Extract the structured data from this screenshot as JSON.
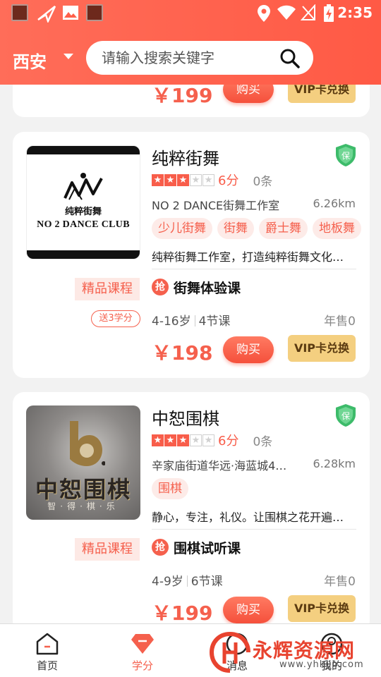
{
  "status_bar": {
    "time": "2:35"
  },
  "header": {
    "city": "西安",
    "search_placeholder": "请输入搜索关键字"
  },
  "prev_card": {
    "price": "￥199",
    "buy_label": "购买",
    "vip_label": "VIP卡兑换"
  },
  "cards": [
    {
      "title": "纯粹街舞",
      "thumb_cn": "纯粹街舞",
      "thumb_en": "NO 2 DANCE CLUB",
      "rating_stars": 3,
      "score": "6分",
      "reviews": "0条",
      "address": "NO 2 DANCE街舞工作室",
      "distance": "6.26km",
      "tags": [
        "少儿街舞",
        "街舞",
        "爵士舞",
        "地板舞"
      ],
      "description": "纯粹街舞工作室，打造纯粹街舞文化…",
      "course_label": "精品课程",
      "credit_badge": "送3学分",
      "grab_icon": "抢",
      "course_name": "街舞体验课",
      "age": "4-16岁",
      "lessons": "4节课",
      "sales": "年售0",
      "price": "￥198",
      "buy_label": "购买",
      "vip_label": "VIP卡兑换"
    },
    {
      "title": "中恕围棋",
      "thumb_big": "中恕围棋",
      "thumb_sub": "智·得·棋·乐",
      "rating_stars": 3,
      "score": "6分",
      "reviews": "0条",
      "address": "辛家庙街道华远·海蓝城4…",
      "distance": "6.28km",
      "tags": [
        "围棋"
      ],
      "description": "静心，专注，礼仪。让围棋之花开遍…",
      "course_label": "精品课程",
      "grab_icon": "抢",
      "course_name": "围棋试听课",
      "age": "4-9岁",
      "lessons": "6节课",
      "sales": "年售0",
      "price": "￥199",
      "buy_label": "购买",
      "vip_label": "VIP卡兑换"
    }
  ],
  "tabbar": {
    "home": "首页",
    "learn": "学分",
    "third": "消息",
    "fourth": "我的"
  },
  "watermark": {
    "text": "永辉资源网",
    "url": "www.yhkjjb.com"
  },
  "colors": {
    "accent": "#f5604d",
    "header_bg": "#ff5f4a",
    "vip_bg": "#f4cf80",
    "shield_green": "#3dbb6a"
  }
}
